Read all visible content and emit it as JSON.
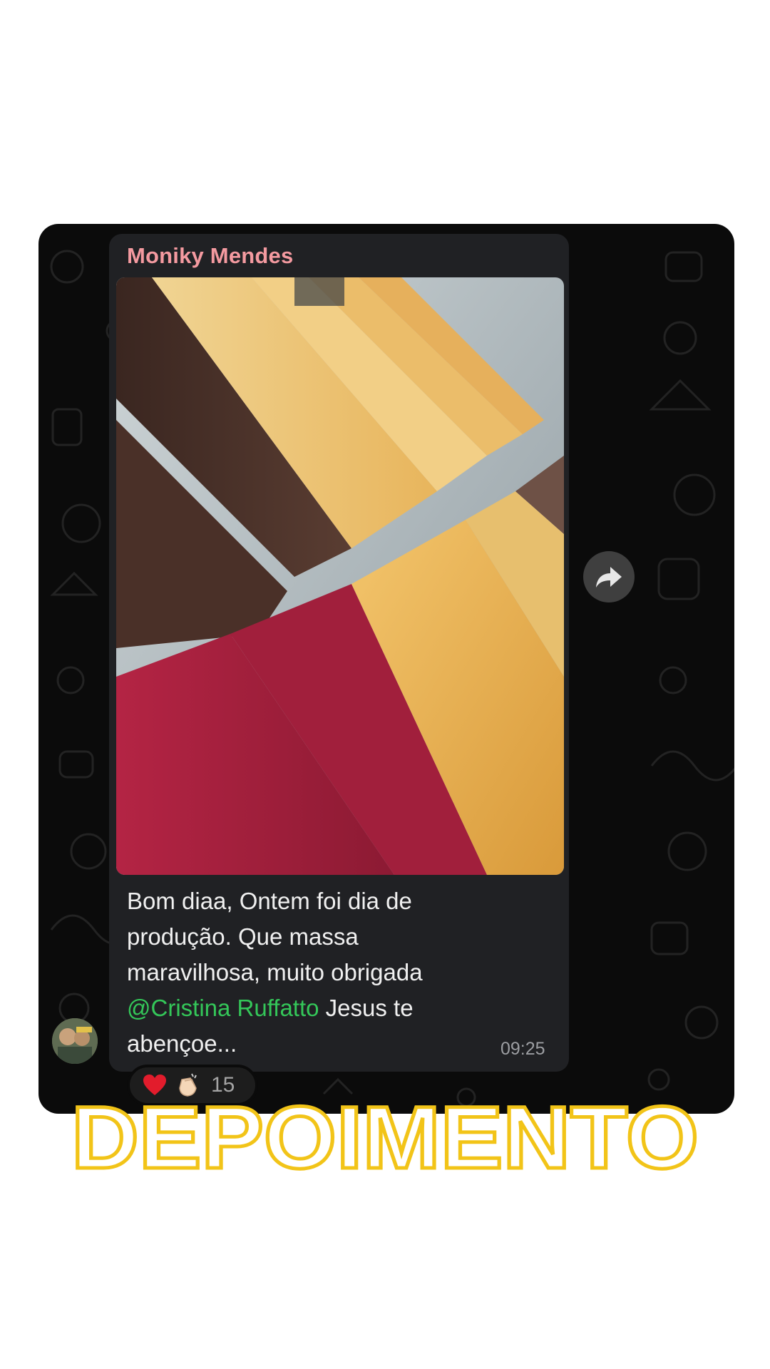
{
  "chat": {
    "sender_name": "Moniky Mendes",
    "message": {
      "line1": "Bom diaa, Ontem foi dia de",
      "line2": "produção. Que massa",
      "line3": "maravilhosa, muito obrigada",
      "mention": "@Cristina Ruffatto",
      "after_mention": " Jesus te",
      "line5": "abençoe..."
    },
    "timestamp": "09:25",
    "reactions": {
      "emojis": [
        "red-heart",
        "clapping-hands"
      ],
      "count": "15"
    },
    "icons": {
      "forward": "forward-arrow-icon"
    }
  },
  "overlay": {
    "title": "DEPOIMENTO"
  },
  "colors": {
    "card_bg": "#0b0b0b",
    "bubble_bg": "#202124",
    "sender": "#f49aa0",
    "mention": "#34c759",
    "title_outline": "#f2c418"
  }
}
